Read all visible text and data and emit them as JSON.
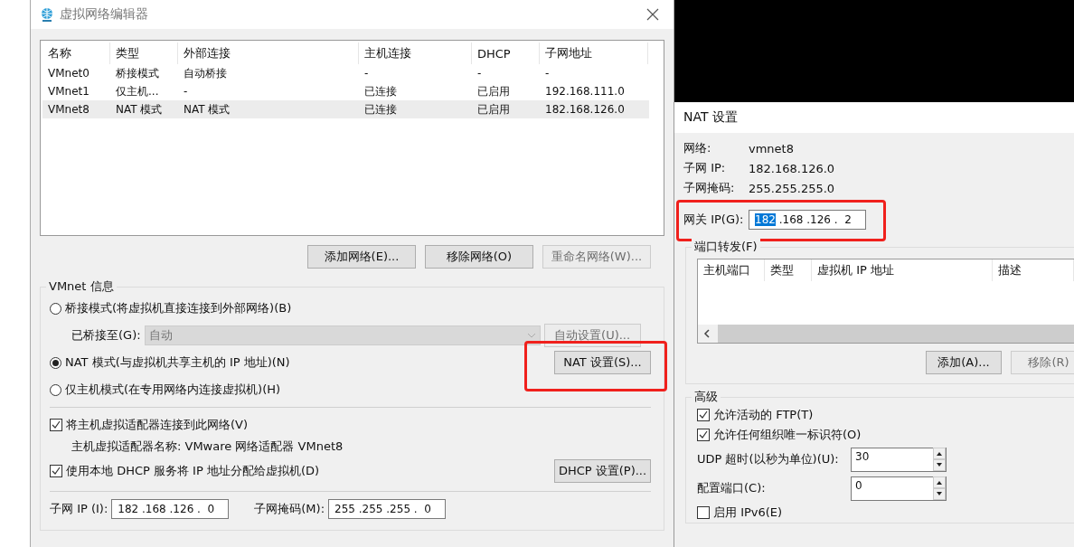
{
  "main_window": {
    "title": "虚拟网络编辑器",
    "table": {
      "columns": [
        "名称",
        "类型",
        "外部连接",
        "主机连接",
        "DHCP",
        "子网地址"
      ],
      "rows": [
        {
          "cells": [
            "VMnet0",
            "桥接模式",
            "自动桥接",
            "-",
            "-",
            "-"
          ],
          "selected": false
        },
        {
          "cells": [
            "VMnet1",
            "仅主机...",
            "-",
            "已连接",
            "已启用",
            "192.168.111.0"
          ],
          "selected": false
        },
        {
          "cells": [
            "VMnet8",
            "NAT 模式",
            "NAT 模式",
            "已连接",
            "已启用",
            "182.168.126.0"
          ],
          "selected": true
        }
      ]
    },
    "buttons": [
      {
        "label": "添加网络(E)...",
        "disabled": false
      },
      {
        "label": "移除网络(O)",
        "disabled": false
      },
      {
        "label": "重命名网络(W)...",
        "disabled": true
      }
    ],
    "vmnet_info": {
      "title": "VMnet 信息",
      "modes": [
        {
          "label": "桥接模式(将虚拟机直接连接到外部网络)(B)",
          "selected": false
        },
        {
          "label": "NAT 模式(与虚拟机共享主机的 IP 地址)(N)",
          "selected": true
        },
        {
          "label": "仅主机模式(在专用网络内连接虚拟机)(H)",
          "selected": false
        }
      ],
      "bridged_to": {
        "label": "已桥接至(G):",
        "value": "自动",
        "disabled": true
      },
      "auto_settings_button": {
        "label": "自动设置(U)...",
        "disabled": true
      },
      "nat_settings_button": {
        "label": "NAT 设置(S)...",
        "disabled": false,
        "highlighted": true
      },
      "host_adapter": {
        "label": "将主机虚拟适配器连接到此网络(V)",
        "checked": true
      },
      "adapter_name": "主机虚拟适配器名称: VMware 网络适配器 VMnet8",
      "dhcp": {
        "label": "使用本地 DHCP 服务将 IP 地址分配给虚拟机(D)",
        "checked": true
      },
      "dhcp_settings_button": {
        "label": "DHCP 设置(P)...",
        "disabled": false
      },
      "subnet_ip": {
        "label": "子网 IP (I):",
        "value": "182 .168 .126 .  0"
      },
      "subnet_mask": {
        "label": "子网掩码(M):",
        "value": "255 .255 .255 .  0"
      }
    }
  },
  "nat_window": {
    "title": "NAT 设置",
    "info": [
      {
        "label": "网络:",
        "value": "vmnet8"
      },
      {
        "label": "子网 IP:",
        "value": "182.168.126.0"
      },
      {
        "label": "子网掩码:",
        "value": "255.255.255.0"
      }
    ],
    "gateway": {
      "label": "网关 IP(G):",
      "parts": [
        {
          "text": "182",
          "selected": true
        },
        {
          "text": " .168 .126 .  2",
          "selected": false
        }
      ],
      "highlighted": true
    },
    "port_forwarding": {
      "title": "端口转发(F)",
      "columns": [
        "主机端口",
        "类型",
        "虚拟机 IP 地址",
        "描述"
      ],
      "buttons": [
        {
          "label": "添加(A)...",
          "disabled": false
        },
        {
          "label": "移除(R)",
          "disabled": true
        }
      ]
    },
    "advanced": {
      "title": "高级",
      "checks": [
        {
          "label": "允许活动的 FTP(T)",
          "checked": true
        },
        {
          "label": "允许任何组织唯一标识符(O)",
          "checked": true
        }
      ],
      "spinners": [
        {
          "label": "UDP 超时(以秒为单位)(U):",
          "value": "30"
        },
        {
          "label": "配置端口(C):",
          "value": "0"
        }
      ],
      "ipv6": {
        "label": "启用 IPv6(E)",
        "checked": false
      }
    }
  }
}
